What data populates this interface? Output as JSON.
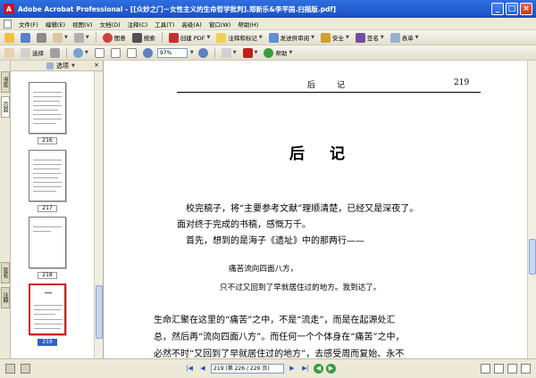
{
  "window": {
    "title": "Adobe Acrobat Professional - [[众妙之门－女性主义的生命哲学批判].郑新乐&李平国.扫描版.pdf]",
    "controls": {
      "minimize": "_",
      "maximize": "□",
      "close": "×"
    }
  },
  "menu": [
    "文件(F)",
    "编辑(E)",
    "视图(V)",
    "文档(D)",
    "注释(C)",
    "工具(T)",
    "高级(A)",
    "窗口(W)",
    "帮助(H)"
  ],
  "toolbar1": {
    "save_label": "图意",
    "search_label": "搜索",
    "create_pdf_label": "创建 PDF",
    "review_label": "注释和标记",
    "send_review_label": "发送供审阅",
    "secure_label": "安全",
    "sign_label": "签名",
    "forms_label": "表单"
  },
  "toolbar2": {
    "select_label": "选择",
    "zoom_value": "97%",
    "help_label": "帮助"
  },
  "nav_tabs": [
    "书签",
    "页面",
    "签名",
    "注释"
  ],
  "pages_panel": {
    "header_label": "选项",
    "close": "×",
    "thumbnails": [
      {
        "label": "216",
        "selected": false
      },
      {
        "label": "217",
        "selected": false
      },
      {
        "label": "218",
        "selected": false
      },
      {
        "label": "219",
        "selected": true
      }
    ]
  },
  "document": {
    "running_head_left": "后",
    "running_head_right": "记",
    "page_number": "219",
    "chapter_title": "后记",
    "paragraphs": [
      "校完稿子，将“主要参考文献”理顺清楚，已经又是深夜了。",
      "面对终于完成的书稿，感慨万千。",
      "首先，想到的是海子《遗址》中的那两行——"
    ],
    "verse": [
      "痛苦流向四面八方，",
      "只不过又回到了早就居住过的地方。我到达了。"
    ],
    "body": [
      "生命汇聚在这里的“痛苦”之中，不是“流走”，而是在起源处汇",
      "总，然后再“流向四面八方”。而任何一个个体身在“痛苦”之中，",
      "必然不时“又回到了早就居住过的地方”，去感受周而复始、永不"
    ]
  },
  "status": {
    "page_field": "219 (第 226 / 229 页)"
  }
}
